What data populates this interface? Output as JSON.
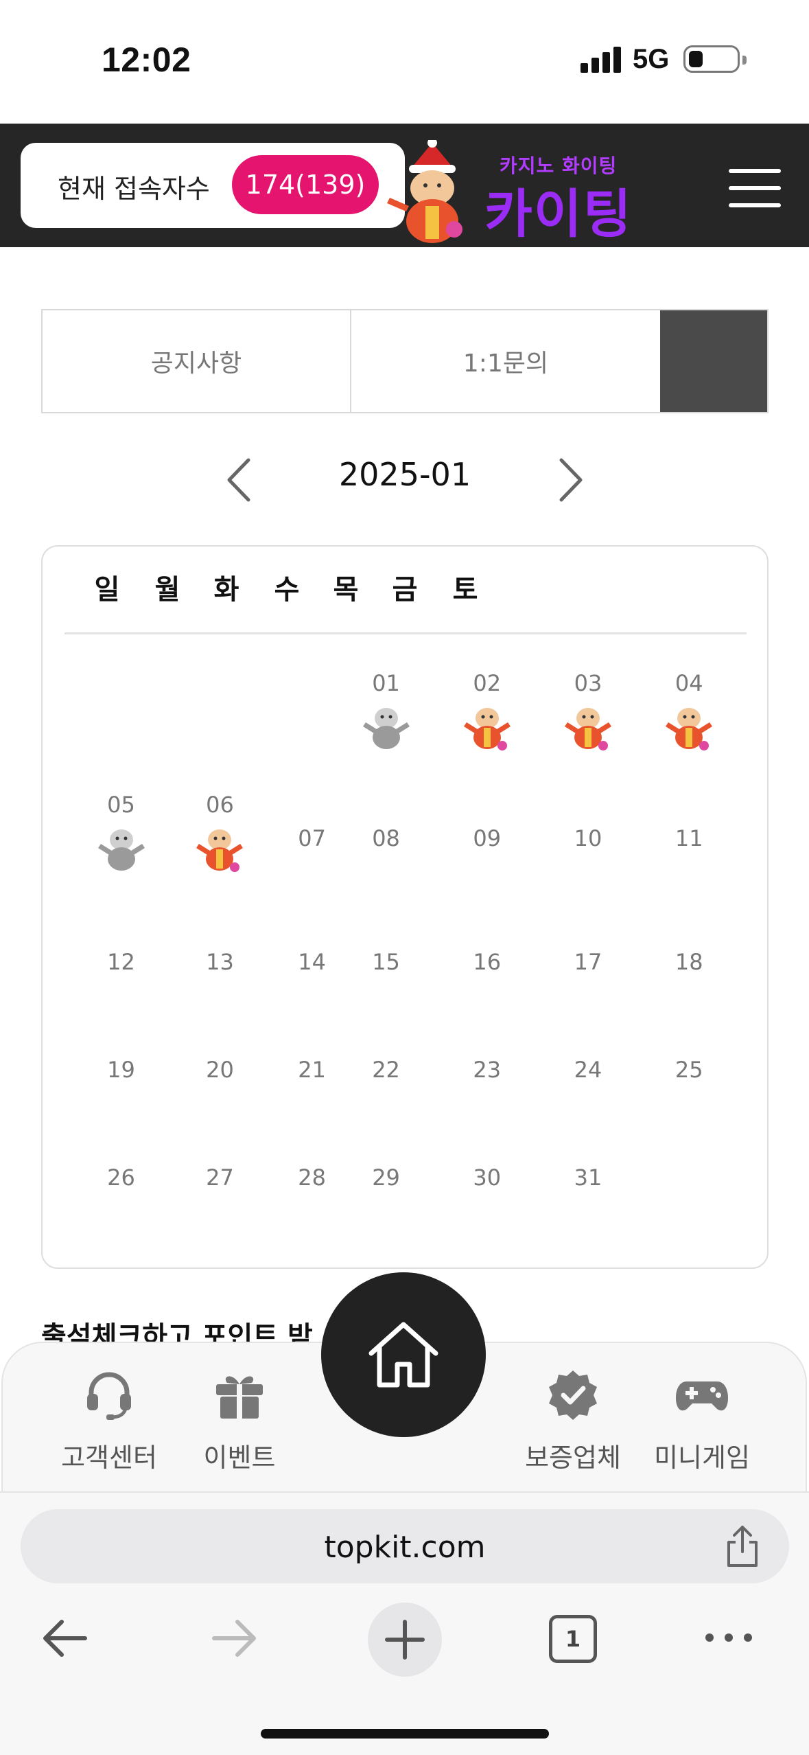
{
  "status_bar": {
    "time": "12:02",
    "network": "5G"
  },
  "header": {
    "users_label": "현재 접속자수",
    "users_count": "174(139)",
    "brand_sub": "카지노 화이팅",
    "brand_main": "카이팅",
    "menu_icon": "hamburger-icon"
  },
  "tabs": [
    {
      "label": "공지사항"
    },
    {
      "label": "1:1문의"
    },
    {
      "label": ""
    }
  ],
  "calendar": {
    "month": "2025-01",
    "weekdays": [
      "일",
      "월",
      "화",
      "수",
      "목",
      "금",
      "토"
    ],
    "days": [
      "01",
      "02",
      "03",
      "04",
      "05",
      "06",
      "07",
      "08",
      "09",
      "10",
      "11",
      "12",
      "13",
      "14",
      "15",
      "16",
      "17",
      "18",
      "19",
      "20",
      "21",
      "22",
      "23",
      "24",
      "25",
      "26",
      "27",
      "28",
      "29",
      "30",
      "31"
    ],
    "stamped": {
      "01": "gray",
      "02": "color",
      "03": "color",
      "04": "color",
      "05": "gray",
      "06": "color"
    },
    "stamp_colors": {
      "color": "#e8532d",
      "gray": "#9a9a9a"
    }
  },
  "promo": {
    "text": "출석체크하고 포인트 받"
  },
  "bottom_nav": {
    "customer_center": "고객센터",
    "events": "이벤트",
    "verified": "보증업체",
    "mini_games": "미니게임"
  },
  "browser": {
    "url": "topkit.com",
    "tab_count": "1"
  },
  "colors": {
    "accent": "#e5156f",
    "brand": "#9b2cf5",
    "header_bg": "#262626"
  }
}
